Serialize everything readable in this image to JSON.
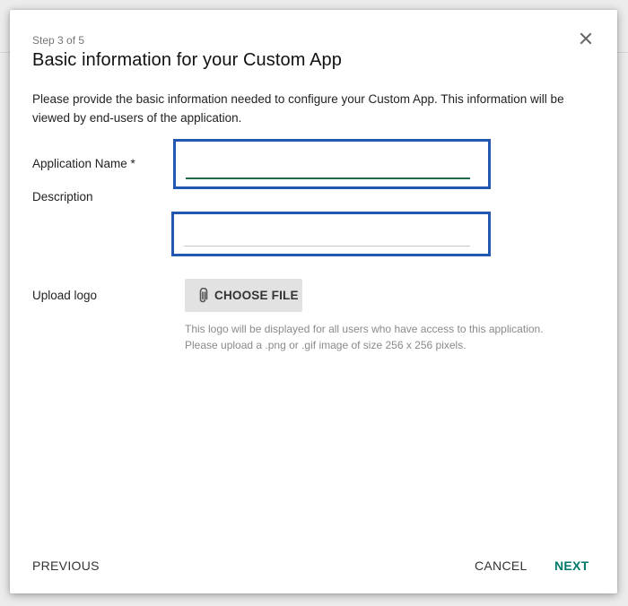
{
  "dialog": {
    "step": "Step 3 of 5",
    "title": "Basic information for your Custom App",
    "close_icon": "close-icon",
    "intro": "Please provide the basic information needed to configure your Custom App. This information will be viewed by end-users of the application."
  },
  "form": {
    "app_name_label": "Application Name *",
    "app_name_value": "",
    "description_label": "Description",
    "description_value": "",
    "upload_label": "Upload logo",
    "choose_file_label": "CHOOSE FILE",
    "attach_icon": "paperclip-icon",
    "hint_line1": "This logo will be displayed for all users who have access to this application.",
    "hint_line2": "Please upload a .png or .gif image of size 256 x 256 pixels."
  },
  "footer": {
    "previous_label": "PREVIOUS",
    "cancel_label": "CANCEL",
    "next_label": "NEXT"
  },
  "colors": {
    "highlight_border": "#2258b0",
    "accent_green": "#00796b",
    "focused_underline": "#1e6b4a",
    "text_primary": "#222222"
  }
}
